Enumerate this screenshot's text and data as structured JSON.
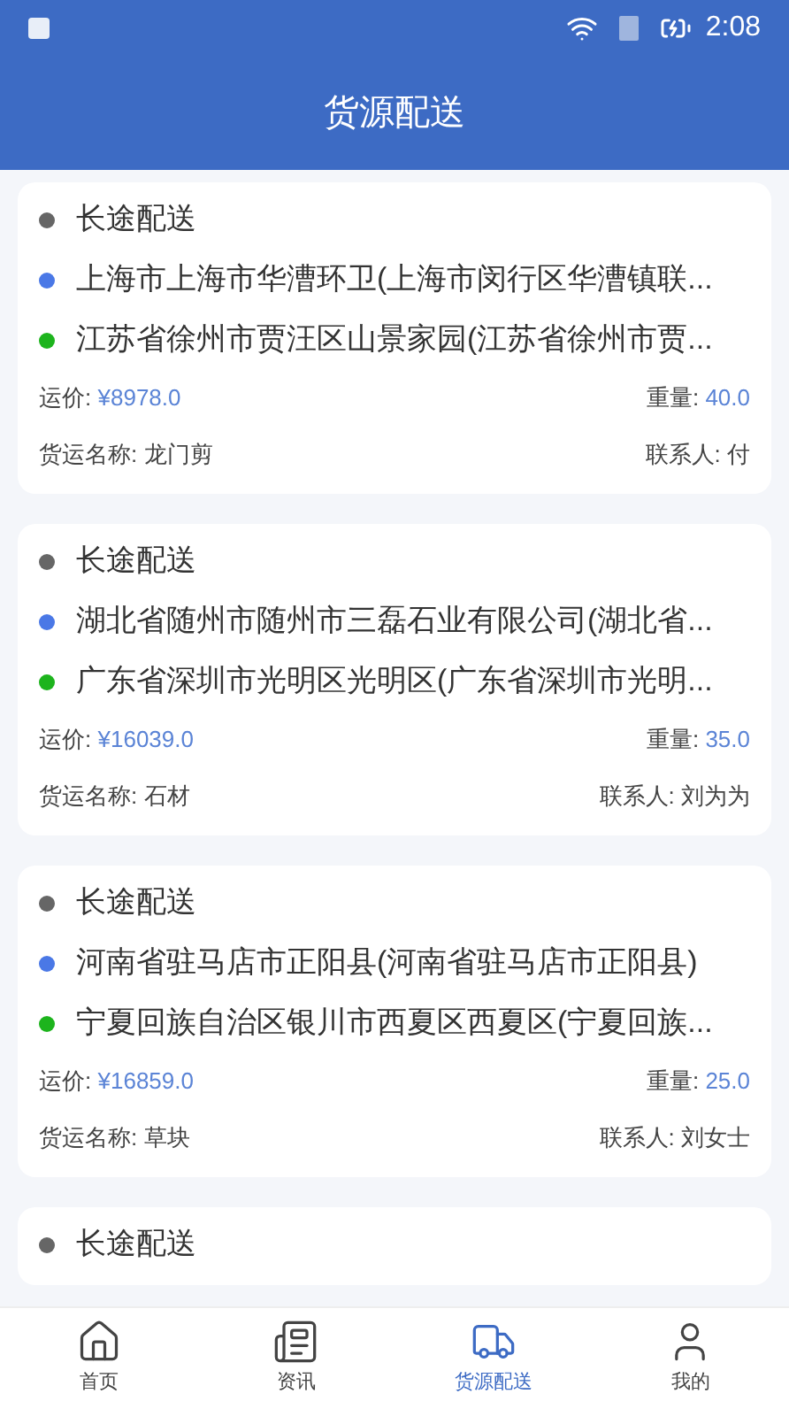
{
  "status_bar": {
    "time": "2:08"
  },
  "header": {
    "title": "货源配送"
  },
  "orders": [
    {
      "type": "长途配送",
      "from": "上海市上海市华漕环卫(上海市闵行区华漕镇联...",
      "to": "江苏省徐州市贾汪区山景家园(江苏省徐州市贾...",
      "price_label": "运价:",
      "price": "¥8978.0",
      "weight_label": "重量:",
      "weight": "40.0",
      "cargo_label": "货运名称:",
      "cargo": "龙门剪",
      "contact_label": "联系人:",
      "contact": "付"
    },
    {
      "type": "长途配送",
      "from": "湖北省随州市随州市三磊石业有限公司(湖北省...",
      "to": "广东省深圳市光明区光明区(广东省深圳市光明...",
      "price_label": "运价:",
      "price": "¥16039.0",
      "weight_label": "重量:",
      "weight": "35.0",
      "cargo_label": "货运名称:",
      "cargo": "石材",
      "contact_label": "联系人:",
      "contact": "刘为为"
    },
    {
      "type": "长途配送",
      "from": "河南省驻马店市正阳县(河南省驻马店市正阳县)",
      "to": "宁夏回族自治区银川市西夏区西夏区(宁夏回族...",
      "price_label": "运价:",
      "price": "¥16859.0",
      "weight_label": "重量:",
      "weight": "25.0",
      "cargo_label": "货运名称:",
      "cargo": "草块",
      "contact_label": "联系人:",
      "contact": "刘女士"
    },
    {
      "type": "长途配送"
    }
  ],
  "tabs": [
    {
      "kind": "home",
      "label": "首页",
      "selected": false
    },
    {
      "kind": "news",
      "label": "资讯",
      "selected": false
    },
    {
      "kind": "truck",
      "label": "货源配送",
      "selected": true
    },
    {
      "kind": "user",
      "label": "我的",
      "selected": false
    }
  ]
}
